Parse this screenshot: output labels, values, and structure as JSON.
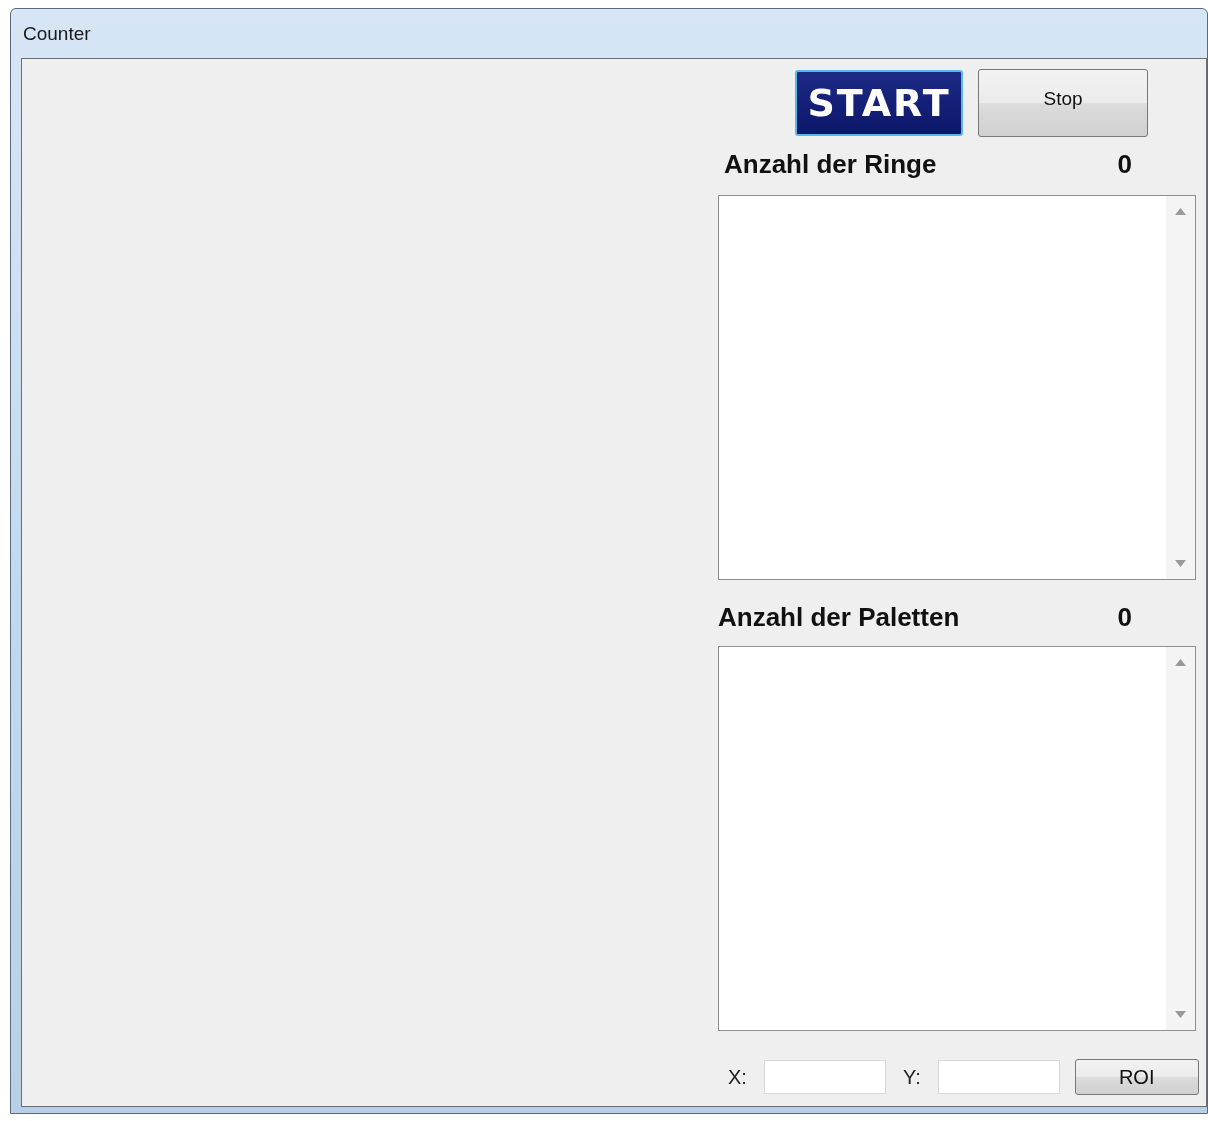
{
  "window": {
    "title": "Counter"
  },
  "buttons": [
    {
      "label": "START",
      "kind": "primary"
    },
    {
      "label": "Stop",
      "kind": "standard"
    }
  ],
  "counters": [
    {
      "label": "Anzahl der Ringe",
      "value": "0"
    },
    {
      "label": "Anzahl der Paletten",
      "value": "0"
    }
  ],
  "coordinates": [
    {
      "label": "X:"
    },
    {
      "label": "Y:"
    }
  ],
  "roi_button": {
    "label": "ROI"
  }
}
